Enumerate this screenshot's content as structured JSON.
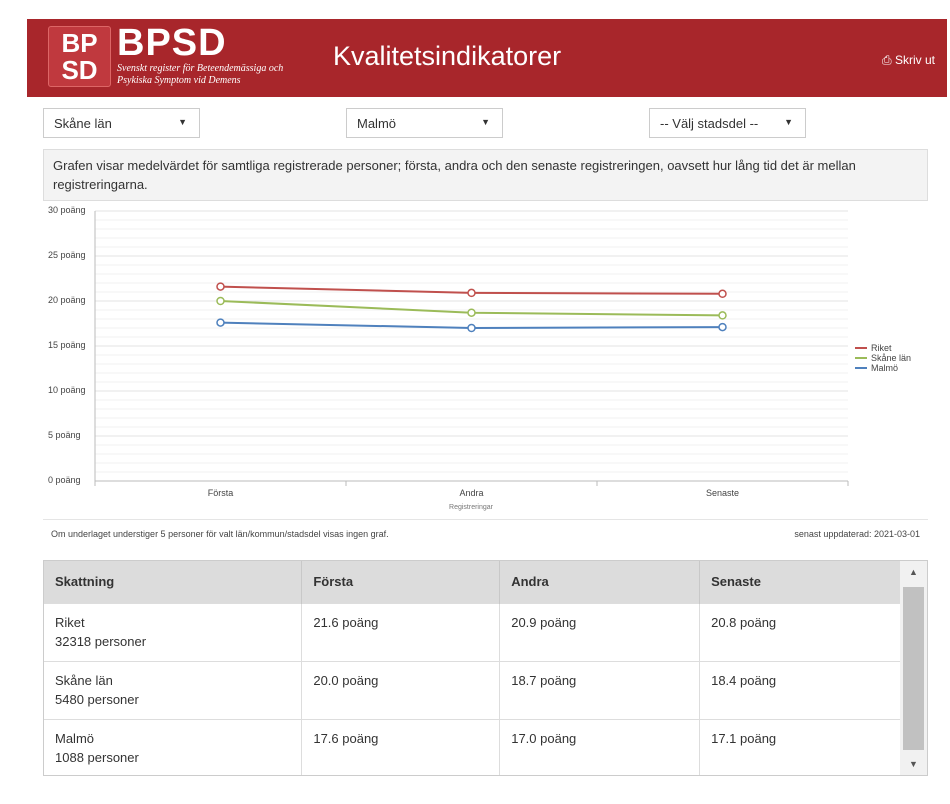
{
  "header": {
    "logo_line1": "BP",
    "logo_line2": "SD",
    "brand_name": "BPSD",
    "brand_sub": "Svenskt register för Beteendemässiga och Psykiska Symptom vid Demens",
    "title": "Kvalitetsindikatorer",
    "print_label": "Skriv ut",
    "print_icon": "printer-icon"
  },
  "filters": {
    "county": "Skåne län",
    "municipality": "Malmö",
    "district": "-- Välj stadsdel --"
  },
  "info_text": "Grafen visar medelvärdet för samtliga registrerade personer; första, andra och den senaste registreringen, oavsett hur lång tid det är mellan registreringarna.",
  "chart_data": {
    "type": "line",
    "categories": [
      "Första",
      "Andra",
      "Senaste"
    ],
    "xlabel": "Registreringar",
    "ylabel": "",
    "ylim": [
      0,
      30
    ],
    "yticks": [
      "0 poäng",
      "5 poäng",
      "10 poäng",
      "15 poäng",
      "20 poäng",
      "25 poäng",
      "30 poäng"
    ],
    "legend_position": "right",
    "series": [
      {
        "name": "Riket",
        "color": "#c0504d",
        "values": [
          21.6,
          20.9,
          20.8
        ]
      },
      {
        "name": "Skåne län",
        "color": "#9bbb59",
        "values": [
          20.0,
          18.7,
          18.4
        ]
      },
      {
        "name": "Malmö",
        "color": "#4f81bd",
        "values": [
          17.6,
          17.0,
          17.1
        ]
      }
    ]
  },
  "footnote": "Om underlaget understiger 5 personer för valt län/kommun/stadsdel visas ingen graf.",
  "updated": "senast uppdaterad: 2021-03-01",
  "table": {
    "headers": [
      "Skattning",
      "Första",
      "Andra",
      "Senaste"
    ],
    "rows": [
      {
        "name": "Riket",
        "persons": "32318 personer",
        "values": [
          "21.6 poäng",
          "20.9 poäng",
          "20.8 poäng"
        ]
      },
      {
        "name": "Skåne län",
        "persons": "5480 personer",
        "values": [
          "20.0 poäng",
          "18.7 poäng",
          "18.4 poäng"
        ]
      },
      {
        "name": "Malmö",
        "persons": "1088 personer",
        "values": [
          "17.6 poäng",
          "17.0 poäng",
          "17.1 poäng"
        ]
      }
    ]
  }
}
